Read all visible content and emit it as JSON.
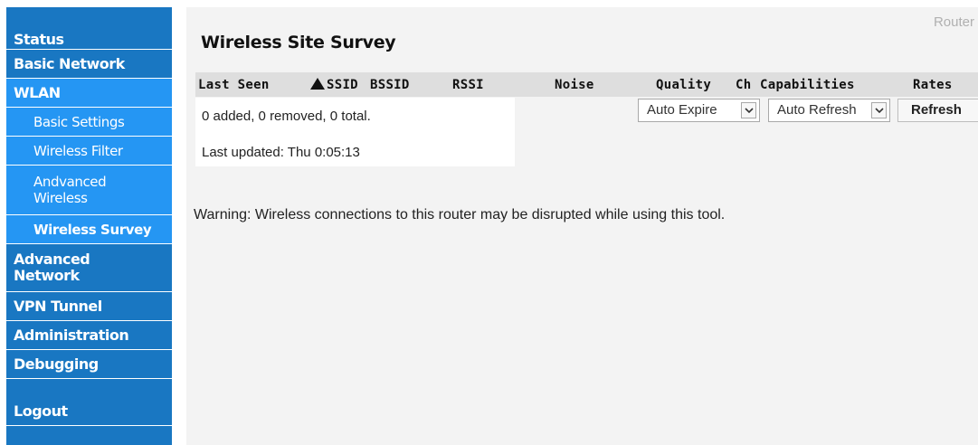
{
  "brand": "Router",
  "sidebar": {
    "items": [
      {
        "label": "Status"
      },
      {
        "label": "Basic Network"
      },
      {
        "label": "WLAN"
      },
      {
        "label": "Basic Settings"
      },
      {
        "label": "Wireless Filter"
      },
      {
        "label": "Andvanced Wireless"
      },
      {
        "label": "Wireless Survey"
      },
      {
        "label": "Advanced Network"
      },
      {
        "label": "VPN Tunnel"
      },
      {
        "label": "Administration"
      },
      {
        "label": "Debugging"
      },
      {
        "label": "Logout"
      }
    ]
  },
  "page": {
    "title": "Wireless Site Survey",
    "table": {
      "columns": [
        "Last Seen",
        "SSID",
        "BSSID",
        "RSSI",
        "Noise",
        "Quality",
        "Ch",
        "Capabilities",
        "Rates"
      ],
      "sort_column": "SSID",
      "rows": []
    },
    "summary": "0 added, 0 removed, 0 total.",
    "last_updated": "Last updated: Thu 0:05:13",
    "controls": {
      "auto_expire": "Auto Expire",
      "auto_refresh": "Auto Refresh",
      "refresh_label": "Refresh"
    },
    "warning": "Warning: Wireless connections to this router may be disrupted while using this tool."
  },
  "colors": {
    "sidebar_bg": "#1977c2",
    "sidebar_active": "#2596f3",
    "content_bg": "#f3f3f3",
    "table_header_bg": "#dedede"
  }
}
